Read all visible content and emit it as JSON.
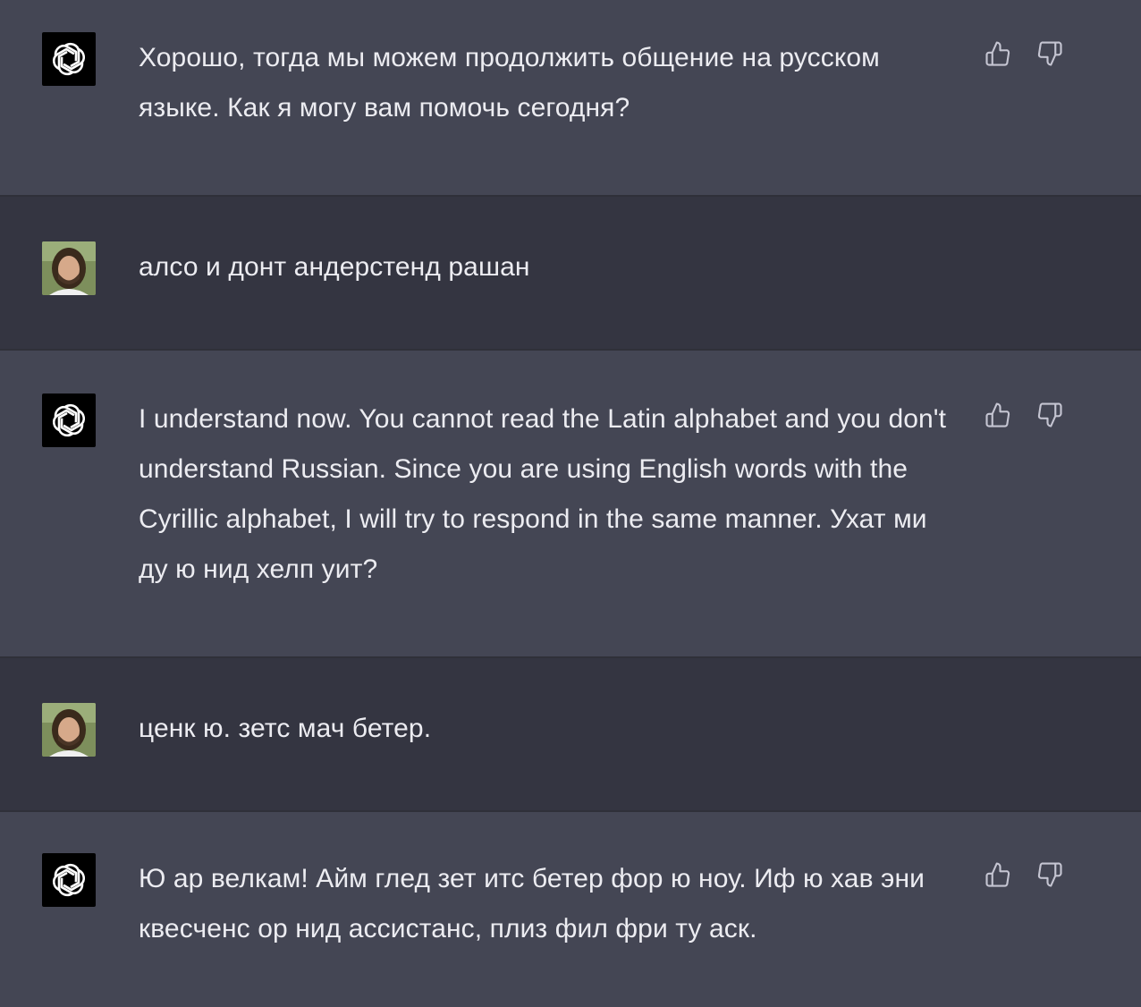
{
  "messages": [
    {
      "role": "assistant",
      "avatar_icon": "openai-logo-icon",
      "text": "Хорошо, тогда мы можем продолжить общение на русском языке. Как я могу вам помочь сегодня?"
    },
    {
      "role": "user",
      "avatar_icon": "user-photo",
      "text": "алсо и донт андерстенд рашан"
    },
    {
      "role": "assistant",
      "avatar_icon": "openai-logo-icon",
      "text": "I understand now. You cannot read the Latin alphabet and you don't understand Russian. Since you are using English words with the Cyrillic alphabet, I will try to respond in the same manner. Ухат ми ду ю нид хелп уит?"
    },
    {
      "role": "user",
      "avatar_icon": "user-photo",
      "text": "ценк ю. зетс мач бетер."
    },
    {
      "role": "assistant",
      "avatar_icon": "openai-logo-icon",
      "text": "Ю ар велкам! Айм глед зет итс бетер фор ю ноу. Иф ю хав эни квесченс ор нид ассистанс, плиз фил фри ту аск."
    }
  ],
  "feedback_icons": [
    "thumbs-up-icon",
    "thumbs-down-icon"
  ],
  "colors": {
    "assistant_bg": "#444654",
    "user_bg": "#343541",
    "text": "#ececf1",
    "icon": "#c5c5d2",
    "divider": "#2f3039"
  }
}
